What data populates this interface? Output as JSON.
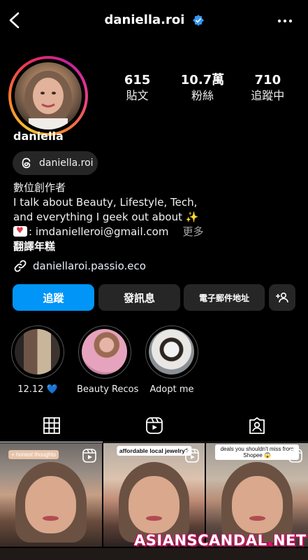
{
  "header": {
    "title": "daniella.roi"
  },
  "stats": [
    {
      "value": "615",
      "label": "貼文"
    },
    {
      "value": "10.7萬",
      "label": "粉絲"
    },
    {
      "value": "710",
      "label": "追蹤中"
    }
  ],
  "profile": {
    "name": "daniella",
    "threads_handle": "daniella.roi",
    "bio_category": "數位創作者",
    "bio_line1": "I talk about Beauty, Lifestyle, Tech,",
    "bio_line2": "and everything I geek out about ✨",
    "bio_email": ": imdanielleroi@gmail.com",
    "bio_more": "更多",
    "translate": "翻譯年糕",
    "link": "daniellaroi.passio.eco"
  },
  "buttons": {
    "follow": "追蹤",
    "message": "發訊息",
    "email": "電子郵件地址"
  },
  "highlights": [
    {
      "label": "12.12 💙"
    },
    {
      "label": "Beauty Recos"
    },
    {
      "label": "Adopt me"
    }
  ],
  "grid": {
    "captions": [
      "+ honest thoughts",
      "affordable local jewelry?",
      "deals you shouldn't miss from Shopee 😱"
    ]
  },
  "watermark": {
    "part1": "ASIANSCANDAL",
    "dot": ".",
    "part2": "NET"
  }
}
